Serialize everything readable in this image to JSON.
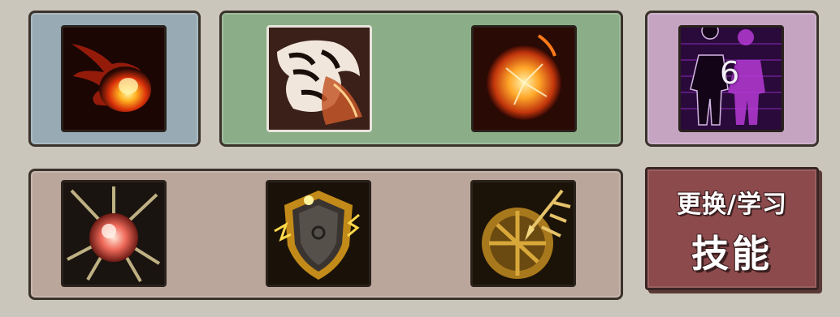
{
  "skill_panels": {
    "active": [
      {
        "icon": "fire-comet-icon"
      }
    ],
    "combo": [
      {
        "icon": "tiger-roar-icon"
      },
      {
        "icon": "sun-orb-icon"
      }
    ],
    "special": [
      {
        "icon": "shadow-clone-icon",
        "count": "6"
      }
    ],
    "passive": [
      {
        "icon": "radiant-orb-icon"
      },
      {
        "icon": "lightning-shield-icon"
      },
      {
        "icon": "golden-strike-icon"
      }
    ]
  },
  "change_skill_button": {
    "line1": "更换/学习",
    "line2": "技能"
  },
  "colors": {
    "background": "#cbc6bc",
    "blue_panel": "#98abb4",
    "green_panel": "#8bae88",
    "purple_panel": "#c5a4c2",
    "brown_panel": "#bba69c",
    "button": "#8d4a4c"
  }
}
